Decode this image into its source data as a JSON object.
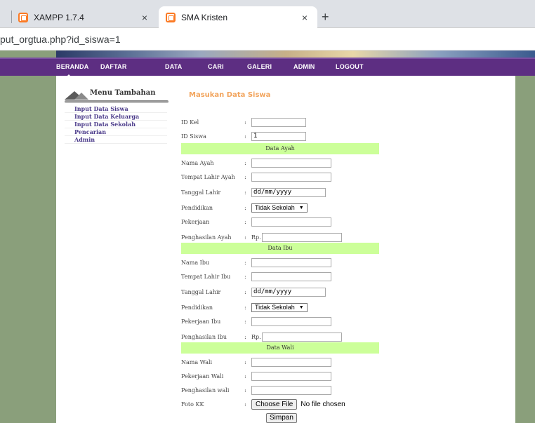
{
  "browser": {
    "tabs": [
      {
        "title": "XAMPP 1.7.4"
      },
      {
        "title": "SMA Kristen"
      }
    ],
    "close_glyph": "×",
    "new_tab_glyph": "+",
    "url": "put_orgtua.php?id_siswa=1"
  },
  "nav": [
    "BERANDA",
    "DAFTAR",
    "DATA",
    "CARI",
    "GALERI",
    "ADMIN",
    "LOGOUT"
  ],
  "sidebar": {
    "title": "Menu Tambahan",
    "items": [
      "Input Data Siswa",
      "Input Data Keluarga",
      "Input Data Sekolah",
      "Pencarian",
      "Admin"
    ]
  },
  "form": {
    "title": "Masukan Data Siswa",
    "colon": ":",
    "id_kel": {
      "label": "ID Kel",
      "value": ""
    },
    "id_siswa": {
      "label": "ID Siswa",
      "value": "1"
    },
    "ayah": {
      "section": "Data Ayah",
      "nama": "Nama Ayah",
      "tempat": "Tempat Lahir Ayah",
      "tanggal": "Tanggal Lahir",
      "tanggal_value": "dd/mm/yyyy",
      "pendidikan": "Pendidikan",
      "pendidikan_value": "Tidak Sekolah",
      "pekerjaan": "Pekerjaan",
      "penghasilan": "Penghasilan Ayah",
      "rp": "Rp."
    },
    "ibu": {
      "section": "Data Ibu",
      "nama": "Nama Ibu",
      "tempat": "Tempat Lahir Ibu",
      "tanggal": "Tanggal Lahir",
      "tanggal_value": "dd/mm/yyyy",
      "pendidikan": "Pendidikan",
      "pendidikan_value": "Tidak Sekolah",
      "pekerjaan": "Pekerjaan Ibu",
      "penghasilan": "Penghasilan Ibu",
      "rp": "Rp."
    },
    "wali": {
      "section": "Data Wali",
      "nama": "Nama Wali",
      "pekerjaan": "Pekerjaan Wali",
      "penghasilan": "Penghasilan wali"
    },
    "foto": {
      "label": "Foto KK",
      "button": "Choose File",
      "status": "No file chosen"
    },
    "submit": "Simpan"
  },
  "colors": {
    "nav_bg": "#5d2e82",
    "page_bg": "#8a9f7b",
    "section_bg": "#ccff99",
    "form_title": "#f2a45c",
    "sidebar_link": "#4b3b8a"
  }
}
